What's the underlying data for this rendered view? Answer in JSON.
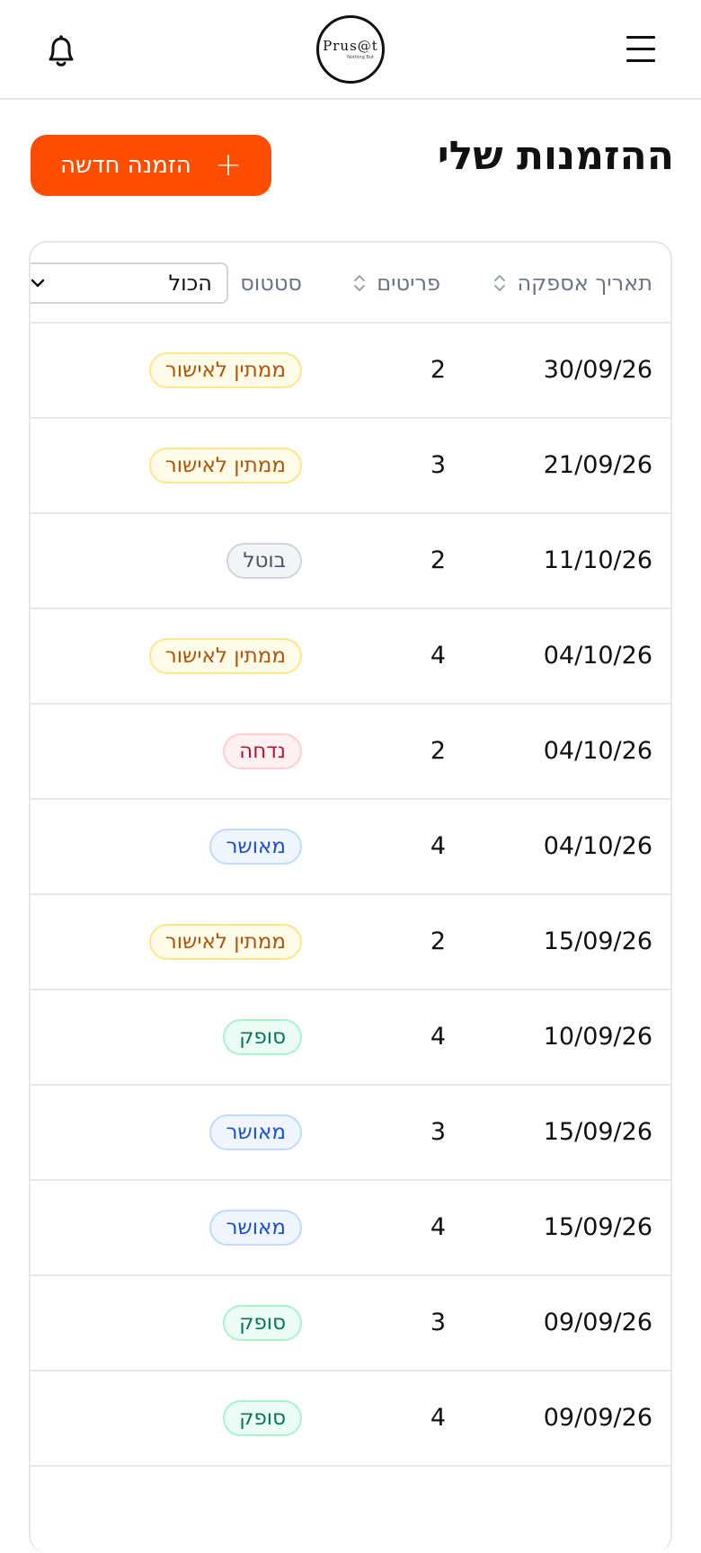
{
  "header": {
    "logo_text": "Prus@t",
    "logo_tagline": "Nothing But"
  },
  "page": {
    "title": "ההזמנות שלי",
    "new_order_label": "הזמנה חדשה"
  },
  "table": {
    "columns": {
      "date": "תאריך אספקה",
      "items": "פריטים",
      "status": "סטטוס"
    },
    "status_filter": {
      "selected": "הכול"
    },
    "rows": [
      {
        "date": "30/09/26",
        "items": "2",
        "status": "ממתין לאישור",
        "status_kind": "pending"
      },
      {
        "date": "21/09/26",
        "items": "3",
        "status": "ממתין לאישור",
        "status_kind": "pending"
      },
      {
        "date": "11/10/26",
        "items": "2",
        "status": "בוטל",
        "status_kind": "cancelled"
      },
      {
        "date": "04/10/26",
        "items": "4",
        "status": "ממתין לאישור",
        "status_kind": "pending"
      },
      {
        "date": "04/10/26",
        "items": "2",
        "status": "נדחה",
        "status_kind": "rejected"
      },
      {
        "date": "04/10/26",
        "items": "4",
        "status": "מאושר",
        "status_kind": "approved"
      },
      {
        "date": "15/09/26",
        "items": "2",
        "status": "ממתין לאישור",
        "status_kind": "pending"
      },
      {
        "date": "10/09/26",
        "items": "4",
        "status": "סופק",
        "status_kind": "delivered"
      },
      {
        "date": "15/09/26",
        "items": "3",
        "status": "מאושר",
        "status_kind": "approved"
      },
      {
        "date": "15/09/26",
        "items": "4",
        "status": "מאושר",
        "status_kind": "approved"
      },
      {
        "date": "09/09/26",
        "items": "3",
        "status": "סופק",
        "status_kind": "delivered"
      },
      {
        "date": "09/09/26",
        "items": "4",
        "status": "סופק",
        "status_kind": "delivered"
      }
    ]
  },
  "colors": {
    "accent": "#ff4d00",
    "pending": {
      "bg": "#fefce8",
      "border": "#fde68a",
      "text": "#b45309"
    },
    "cancelled": {
      "bg": "#f3f4f6",
      "border": "#d1d5db",
      "text": "#4b5563"
    },
    "rejected": {
      "bg": "#fff1f2",
      "border": "#fecdd3",
      "text": "#be123c"
    },
    "approved": {
      "bg": "#eff6ff",
      "border": "#bfdbfe",
      "text": "#1d4ed8"
    },
    "delivered": {
      "bg": "#ecfdf5",
      "border": "#a7f3d0",
      "text": "#047857"
    }
  },
  "icons": {
    "bell": "bell-icon",
    "menu": "hamburger-menu-icon",
    "plus": "plus-icon",
    "sort": "sort-icon"
  }
}
